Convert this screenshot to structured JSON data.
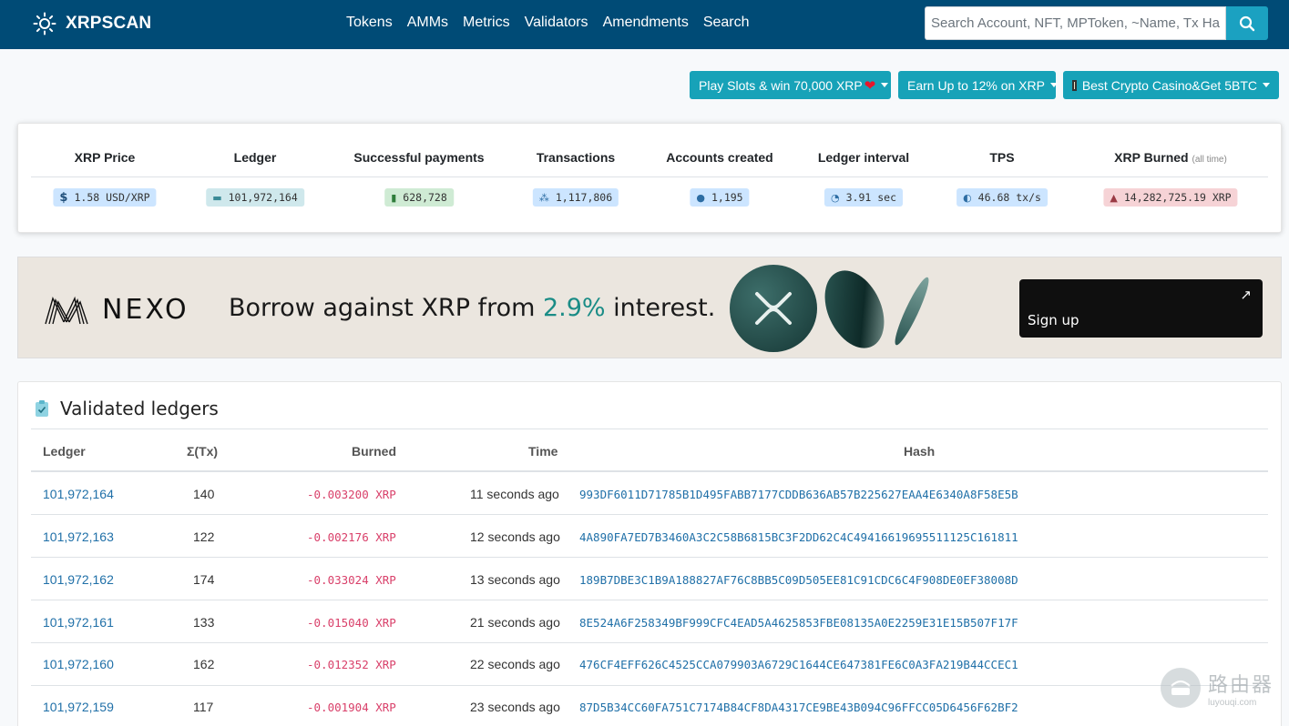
{
  "nav": {
    "brand": "XRPSCAN",
    "links": [
      "Tokens",
      "AMMs",
      "Metrics",
      "Validators",
      "Amendments",
      "Search"
    ],
    "search_placeholder": "Search Account, NFT, MPToken, ~Name, Tx Hash"
  },
  "promos": [
    {
      "label": "Play Slots & win 70,000 XRP",
      "heart": "❤"
    },
    {
      "label": "Earn Up to 12% on XRP"
    },
    {
      "label": "Best Crypto Casino&Get 5BTC"
    }
  ],
  "stats": [
    {
      "head": "XRP Price",
      "badge": "1.58 USD/XRP",
      "icon": "dollar-icon",
      "glyph": "$"
    },
    {
      "head": "Ledger",
      "badge": "101,972,164",
      "icon": "ledger-icon",
      "glyph": "▬"
    },
    {
      "head": "Successful payments",
      "badge": "628,728",
      "icon": "receipt-icon",
      "glyph": "▮"
    },
    {
      "head": "Transactions",
      "badge": "1,117,806",
      "icon": "network-icon",
      "glyph": "⁂"
    },
    {
      "head": "Accounts created",
      "badge": "1,195",
      "icon": "users-icon",
      "glyph": "●"
    },
    {
      "head": "Ledger interval",
      "badge": "3.91 sec",
      "icon": "stopwatch-icon",
      "glyph": "◔"
    },
    {
      "head": "TPS",
      "badge": "46.68 tx/s",
      "icon": "gauge-icon",
      "glyph": "◐"
    },
    {
      "head": "XRP Burned",
      "head_small": "(all time)",
      "badge": "14,282,725.19 XRP",
      "icon": "fire-icon",
      "glyph": "▲"
    }
  ],
  "banner": {
    "logo_text": "NEXO",
    "text_before": "Borrow against XRP from ",
    "text_highlight": "2.9%",
    "text_after": " interest.",
    "signup": "Sign up",
    "arrow": "↗"
  },
  "ledgers": {
    "title": "Validated ledgers",
    "columns": [
      "Ledger",
      "Σ(Tx)",
      "Burned",
      "Time",
      "Hash"
    ],
    "rows": [
      {
        "ledger": "101,972,164",
        "tx": "140",
        "burned": "-0.003200 XRP",
        "time": "11 seconds ago",
        "hash": "993DF6011D71785B1D495FABB7177CDDB636AB57B225627EAA4E6340A8F58E5B"
      },
      {
        "ledger": "101,972,163",
        "tx": "122",
        "burned": "-0.002176 XRP",
        "time": "12 seconds ago",
        "hash": "4A890FA7ED7B3460A3C2C58B6815BC3F2DD62C4C49416619695511125C161811"
      },
      {
        "ledger": "101,972,162",
        "tx": "174",
        "burned": "-0.033024 XRP",
        "time": "13 seconds ago",
        "hash": "189B7DBE3C1B9A188827AF76C8BB5C09D505EE81C91CDC6C4F908DE0EF38008D"
      },
      {
        "ledger": "101,972,161",
        "tx": "133",
        "burned": "-0.015040 XRP",
        "time": "21 seconds ago",
        "hash": "8E524A6F258349BF999CFC4EAD5A4625853FBE08135A0E2259E31E15B507F17F"
      },
      {
        "ledger": "101,972,160",
        "tx": "162",
        "burned": "-0.012352 XRP",
        "time": "22 seconds ago",
        "hash": "476CF4EFF626C4525CCA079903A6729C1644CE647381FE6C0A3FA219B44CCEC1"
      },
      {
        "ledger": "101,972,159",
        "tx": "117",
        "burned": "-0.001904 XRP",
        "time": "23 seconds ago",
        "hash": "87D5B34CC60FA751C7174B84CF8DA4317CE9BE43B094C96FFCC05D6456F62BF2"
      }
    ]
  },
  "watermark": {
    "line1": "路由器",
    "line2": "luyouqi.com"
  }
}
